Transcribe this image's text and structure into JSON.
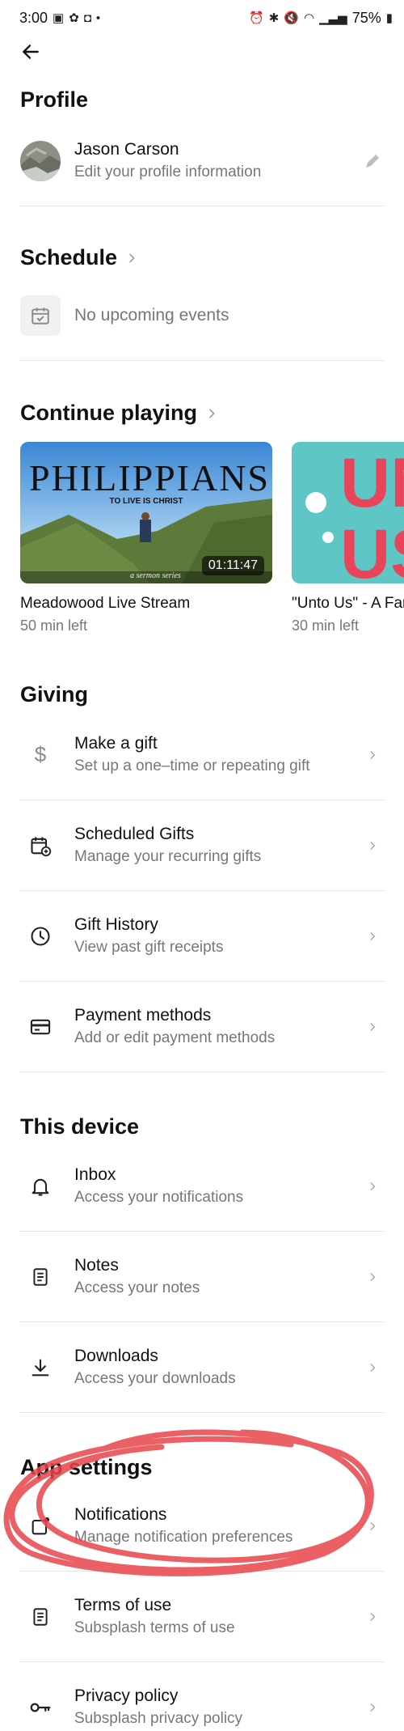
{
  "status_bar": {
    "time": "3:00",
    "battery": "75%"
  },
  "profile": {
    "title": "Profile",
    "name": "Jason Carson",
    "subtitle": "Edit your profile information"
  },
  "schedule": {
    "title": "Schedule",
    "empty_text": "No upcoming events"
  },
  "continue_playing": {
    "title": "Continue playing",
    "items": [
      {
        "title": "Meadowood Live Stream",
        "remaining": "50 min left",
        "duration": "01:11:47",
        "thumb_title": "PHILIPPIANS",
        "thumb_subtitle": "TO LIVE IS CHRIST",
        "thumb_caption": "a sermon series"
      },
      {
        "title": "\"Unto Us\" - A Far",
        "remaining": "30 min left",
        "thumb_text_1": "UN",
        "thumb_text_2": "US"
      }
    ]
  },
  "giving": {
    "title": "Giving",
    "items": [
      {
        "label": "Make a gift",
        "sub": "Set up a one–time or repeating gift",
        "icon": "dollar-icon"
      },
      {
        "label": "Scheduled Gifts",
        "sub": "Manage your recurring gifts",
        "icon": "calendar-add-icon"
      },
      {
        "label": "Gift History",
        "sub": "View past gift receipts",
        "icon": "clock-icon"
      },
      {
        "label": "Payment methods",
        "sub": "Add or edit payment methods",
        "icon": "credit-card-icon"
      }
    ]
  },
  "this_device": {
    "title": "This device",
    "items": [
      {
        "label": "Inbox",
        "sub": "Access your notifications",
        "icon": "bell-icon"
      },
      {
        "label": "Notes",
        "sub": "Access your notes",
        "icon": "notes-icon"
      },
      {
        "label": "Downloads",
        "sub": "Access your downloads",
        "icon": "download-icon"
      }
    ]
  },
  "app_settings": {
    "title": "App settings",
    "items": [
      {
        "label": "Notifications",
        "sub": "Manage notification preferences",
        "icon": "notification-icon"
      },
      {
        "label": "Terms of use",
        "sub": "Subsplash terms of use",
        "icon": "document-icon"
      },
      {
        "label": "Privacy policy",
        "sub": "Subsplash privacy policy",
        "icon": "key-icon"
      }
    ]
  },
  "colors": {
    "scribble": "#e8454a",
    "muted": "#777777"
  }
}
